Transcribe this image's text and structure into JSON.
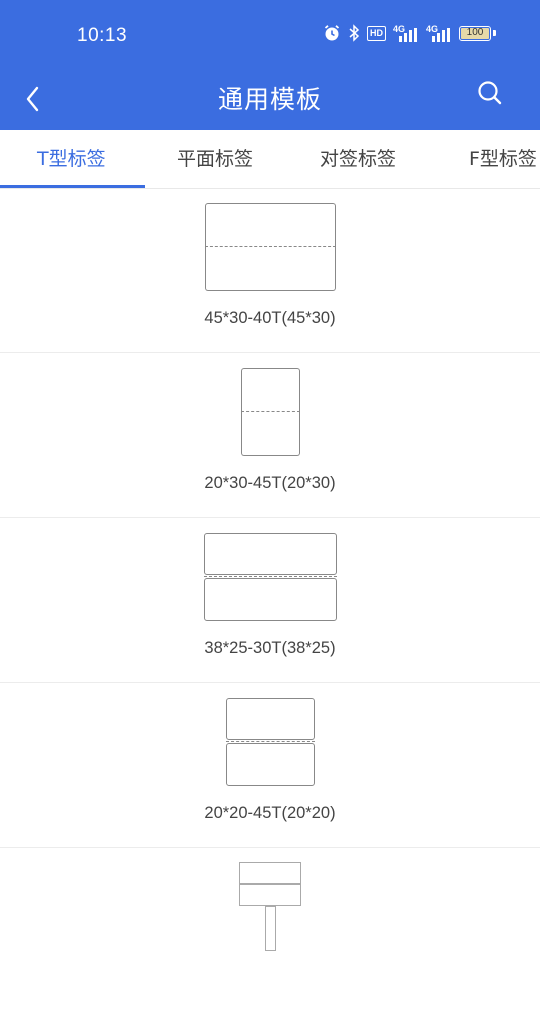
{
  "status_bar": {
    "time": "10:13",
    "icons": [
      "alarm-icon",
      "bluetooth-icon",
      "hd-icon",
      "signal-4g-icon",
      "signal-4g-icon",
      "battery-icon"
    ],
    "hd_label": "HD",
    "net1": "4G",
    "net2": "4G",
    "battery": "100"
  },
  "nav": {
    "title": "通用模板"
  },
  "tabs": [
    {
      "label": "T型标签",
      "active": true
    },
    {
      "label": "平面标签",
      "active": false
    },
    {
      "label": "对签标签",
      "active": false
    },
    {
      "label": "F型标签",
      "active": false
    }
  ],
  "templates": [
    {
      "caption": "45*30-40T(45*30)"
    },
    {
      "caption": "20*30-45T(20*30)"
    },
    {
      "caption": "38*25-30T(38*25)"
    },
    {
      "caption": "20*20-45T(20*20)"
    },
    {
      "caption": ""
    }
  ],
  "colors": {
    "brand": "#3b6de0",
    "text": "#444444",
    "divider": "#ececec"
  }
}
